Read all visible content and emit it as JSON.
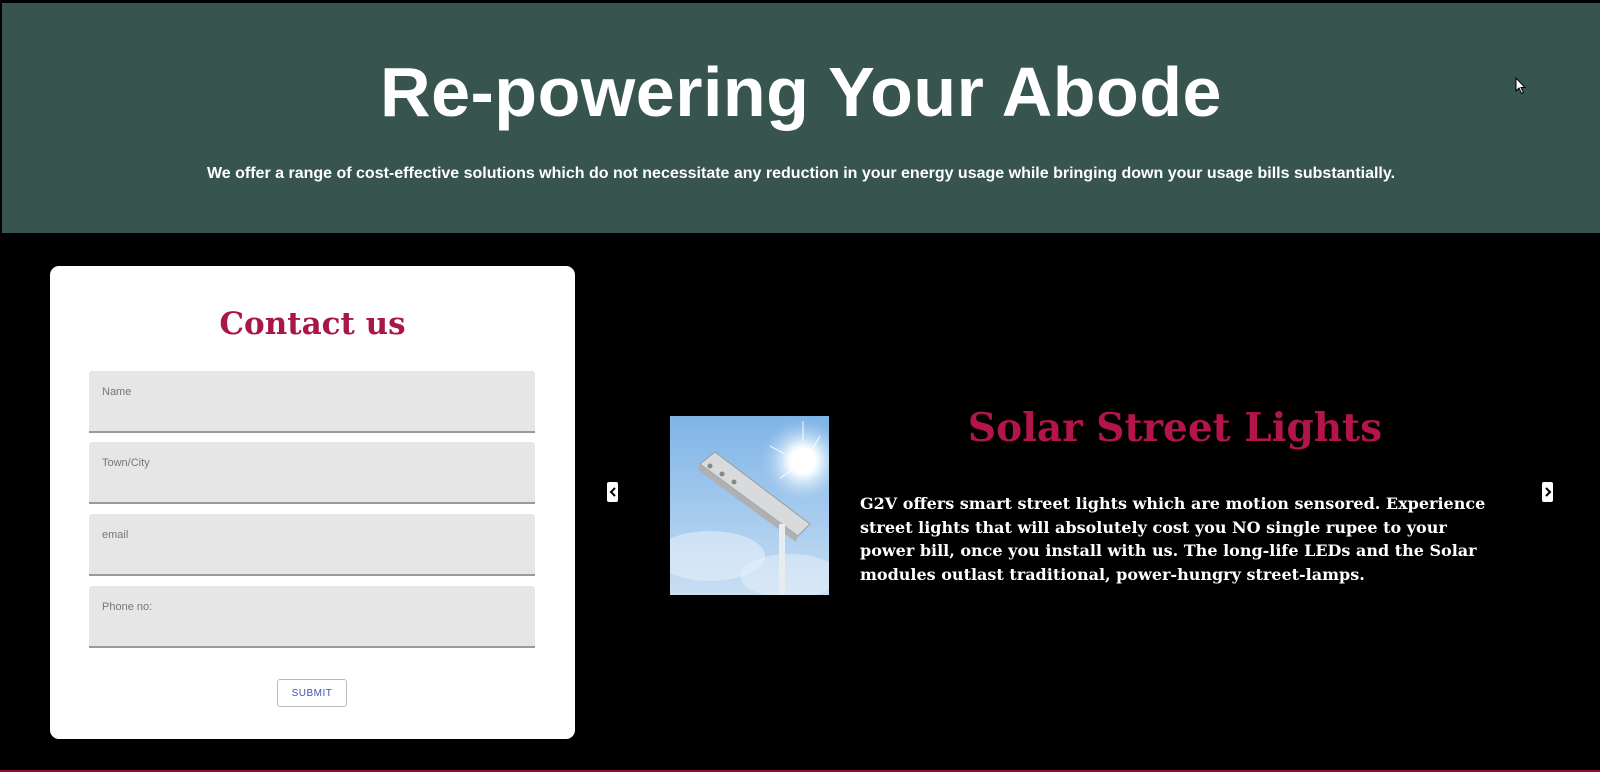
{
  "hero": {
    "title": "Re-powering Your Abode",
    "subtitle": "We offer a range of cost-effective solutions which do not necessitate any reduction in your energy usage while bringing down your usage bills substantially."
  },
  "contact": {
    "title": "Contact us",
    "fields": [
      {
        "placeholder": "Name",
        "value": ""
      },
      {
        "placeholder": "Town/City",
        "value": ""
      },
      {
        "placeholder": "email",
        "value": ""
      },
      {
        "placeholder": "Phone no:",
        "value": ""
      }
    ],
    "submit_label": "SUBMIT"
  },
  "slide": {
    "title": "Solar Street Lights",
    "body": "G2V offers smart street lights which are motion sensored. Experience street lights that will absolutely cost you NO single rupee to your power bill, once you install with us. The long-life LEDs and the Solar modules outlast traditional, power-hungry street-lamps.",
    "image_icon": "solar-street-light-image"
  },
  "carousel": {
    "prev_icon": "chevron-left-icon",
    "next_icon": "chevron-right-icon"
  },
  "colors": {
    "hero_bg": "#37554e",
    "accent": "#b3154a",
    "page_bg": "#000000"
  }
}
